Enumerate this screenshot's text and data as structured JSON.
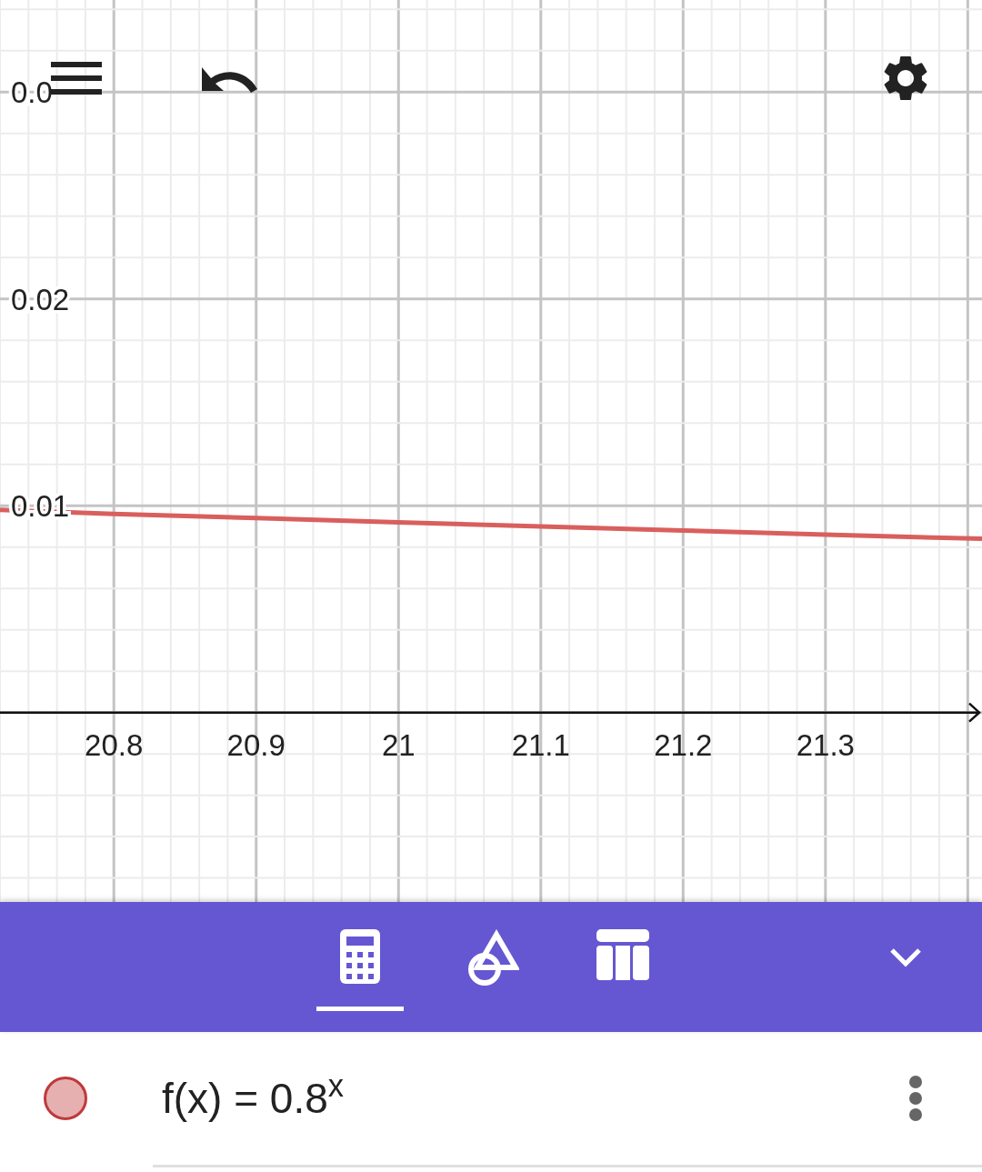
{
  "graph": {
    "chart_data": {
      "type": "line",
      "x": [
        20.72,
        20.8,
        20.9,
        21,
        21.1,
        21.2,
        21.3,
        21.41
      ],
      "series": [
        {
          "color": "#d95f5d",
          "values": [
            0.0098,
            0.0096,
            0.0094,
            0.0092,
            0.009,
            0.0088,
            0.0086,
            0.0084
          ]
        }
      ],
      "grid": true,
      "xlim": [
        20.72,
        21.41
      ],
      "ylim": [
        -0.00916,
        0.03445
      ],
      "xticks": [
        20.8,
        20.9,
        21,
        21.1,
        21.2,
        21.3
      ],
      "yticks": [
        0.01,
        0.02,
        {
          "value": 0.03,
          "label": "0.0"
        }
      ]
    }
  },
  "tabs": [
    {
      "kind": "calculator",
      "selected": true
    },
    {
      "kind": "geometry",
      "selected": false
    },
    {
      "kind": "table",
      "selected": false
    }
  ],
  "algebra": [
    {
      "formula": "f(x) = 0.8$^{x}$",
      "color": "#c0393b"
    }
  ]
}
